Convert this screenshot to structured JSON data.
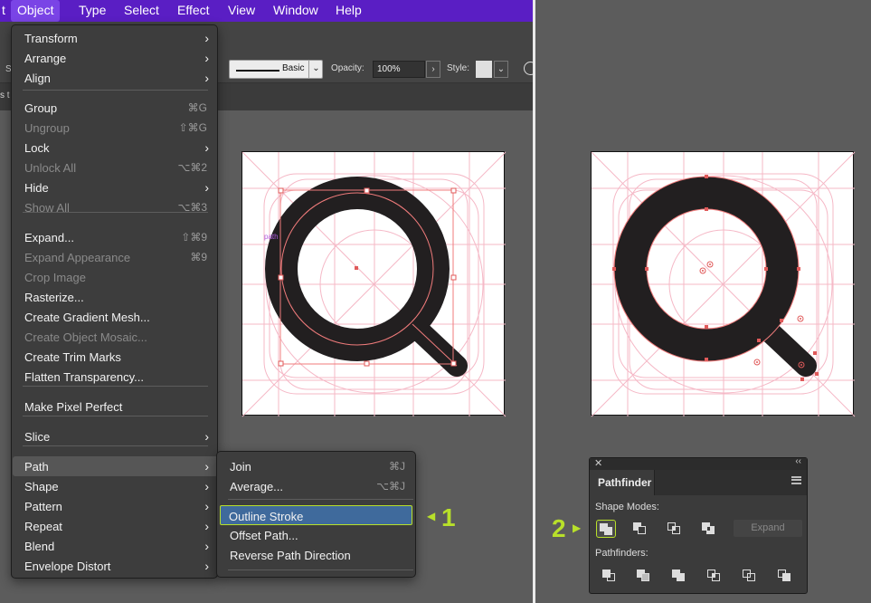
{
  "menubar": {
    "items": [
      "t",
      "Object",
      "Type",
      "Select",
      "Effect",
      "View",
      "Window",
      "Help"
    ],
    "active": "Object"
  },
  "toolbar": {
    "stroke_profile": "Basic",
    "opacity_label": "Opacity:",
    "opacity_value": "100%",
    "style_label": "Style:",
    "left_fragment": "S",
    "tab_fragment": "s t"
  },
  "object_menu": {
    "items": [
      {
        "label": "Transform",
        "submenu": true
      },
      {
        "label": "Arrange",
        "submenu": true
      },
      {
        "label": "Align",
        "submenu": true
      },
      {
        "label": "Group",
        "shortcut": "⌘G"
      },
      {
        "label": "Ungroup",
        "shortcut": "⇧⌘G",
        "disabled": true
      },
      {
        "label": "Lock",
        "submenu": true
      },
      {
        "label": "Unlock All",
        "shortcut": "⌥⌘2",
        "disabled": true
      },
      {
        "label": "Hide",
        "submenu": true
      },
      {
        "label": "Show All",
        "shortcut": "⌥⌘3",
        "disabled": true
      },
      {
        "label": "Expand...",
        "shortcut": "⇧⌘9"
      },
      {
        "label": "Expand Appearance",
        "shortcut": "⌘9",
        "disabled": true
      },
      {
        "label": "Crop Image",
        "disabled": true
      },
      {
        "label": "Rasterize..."
      },
      {
        "label": "Create Gradient Mesh..."
      },
      {
        "label": "Create Object Mosaic...",
        "disabled": true
      },
      {
        "label": "Create Trim Marks"
      },
      {
        "label": "Flatten Transparency..."
      },
      {
        "label": "Make Pixel Perfect"
      },
      {
        "label": "Slice",
        "submenu": true
      },
      {
        "label": "Path",
        "submenu": true,
        "highlighted": true
      },
      {
        "label": "Shape",
        "submenu": true
      },
      {
        "label": "Pattern",
        "submenu": true
      },
      {
        "label": "Repeat",
        "submenu": true
      },
      {
        "label": "Blend",
        "submenu": true
      },
      {
        "label": "Envelope Distort",
        "submenu": true
      }
    ]
  },
  "path_submenu": {
    "items": [
      {
        "label": "Join",
        "shortcut": "⌘J"
      },
      {
        "label": "Average...",
        "shortcut": "⌥⌘J"
      },
      {
        "label": "Outline Stroke",
        "selected": true
      },
      {
        "label": "Offset Path..."
      },
      {
        "label": "Reverse Path Direction"
      }
    ]
  },
  "canvas": {
    "anchor_label": "path"
  },
  "annotations": {
    "step1": "1",
    "step2": "2",
    "accent_color": "#b8e02a"
  },
  "pathfinder": {
    "tab": "Pathfinder",
    "shape_modes_label": "Shape Modes:",
    "pathfinders_label": "Pathfinders:",
    "expand_label": "Expand",
    "shape_modes": [
      "unite-icon",
      "minus-front-icon",
      "intersect-icon",
      "exclude-icon"
    ],
    "pathfinder_ops": [
      "divide-icon",
      "trim-icon",
      "merge-icon",
      "crop-icon",
      "outline-icon",
      "minus-back-icon"
    ]
  }
}
